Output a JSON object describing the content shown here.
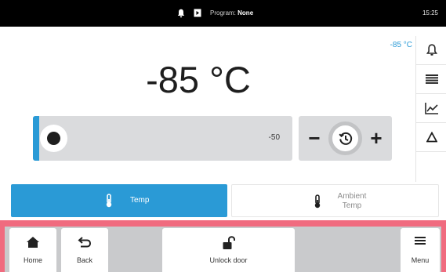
{
  "status_bar": {
    "program_label": "Program:",
    "program_value": "None",
    "time": "15:25",
    "icons": [
      "bell-icon",
      "program-icon"
    ]
  },
  "display": {
    "temperature": "-85 °C",
    "setpoint": "-85 °C"
  },
  "side_tools": [
    "alarm-bell-icon",
    "list-icon",
    "chart-icon",
    "delta-icon"
  ],
  "slider": {
    "value_label": "-50",
    "level_fraction": 0.0
  },
  "stepper": {
    "minus_label": "−",
    "plus_label": "+",
    "center_icon": "timer-icon"
  },
  "tabs": [
    {
      "label": "Temp",
      "active": true,
      "icon": "thermometer-icon"
    },
    {
      "label_line1": "Ambient",
      "label_line2": "Temp",
      "active": false,
      "icon": "thermometer-icon"
    }
  ],
  "bottom_bar": {
    "home": "Home",
    "back": "Back",
    "unlock": "Unlock door",
    "menu": "Menu"
  },
  "colors": {
    "accent": "#2a9ad6",
    "alert_bar": "#f06b7f",
    "status_bar": "#000000"
  }
}
